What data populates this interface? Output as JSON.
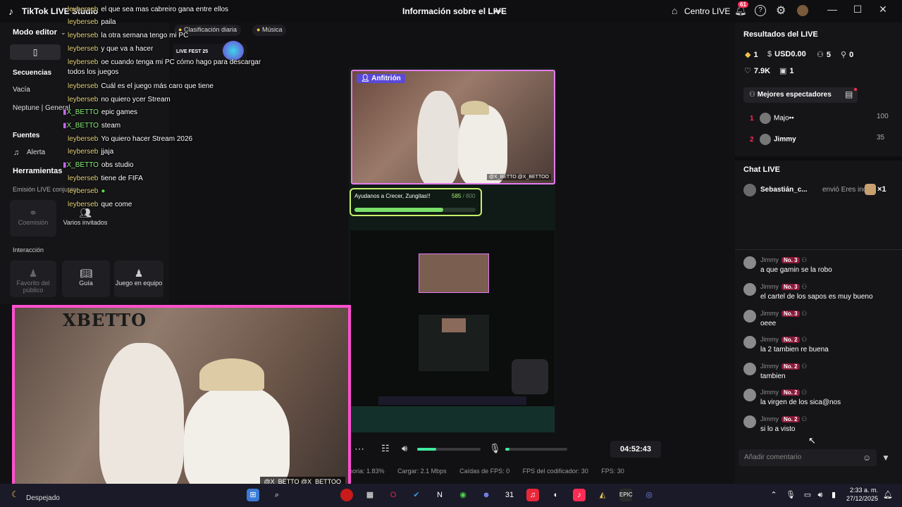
{
  "titlebar": {
    "app_title": "TikTok LIVE Studio",
    "live_info": "Información sobre el LIVE",
    "centro": "Centro LIVE",
    "notifications": "61",
    "win_min": "—",
    "win_max": "☐",
    "win_close": "✕"
  },
  "left": {
    "modo_editor": "Modo editor",
    "secuencias": "Secuencias",
    "vacia": "Vacía",
    "neptune": "Neptune | General",
    "fuentes": "Fuentes",
    "alerta": "Alerta",
    "herramientas": "Herramientas",
    "emision": "Emisión LIVE conjunta",
    "coemision": "Coemisión",
    "varios": "Varios invitados",
    "interaccion": "Interacción",
    "favorito": "Favorito del público",
    "guia": "Guía",
    "juego": "Juego en equipo"
  },
  "pills": {
    "clasificacion": "Clasificación diaria",
    "musica": "Música"
  },
  "overlay_chat": [
    {
      "user": "leyberseb",
      "text": "el que sea mas cabreiro gana entre ellos"
    },
    {
      "user": "leyberseb",
      "text": "paila"
    },
    {
      "user": "leyberseb",
      "text": "la otra semana tengo mi PC"
    },
    {
      "user": "leyberseb",
      "text": "y que va a hacer"
    },
    {
      "user": "leyberseb",
      "text": "oe cuando tenga mi PC cómo hago para descargar todos los juegos"
    },
    {
      "user": "leyberseb",
      "text": "Cuál es el juego más caro que tiene"
    },
    {
      "user": "leyberseb",
      "text": "no quiero ycer Stream"
    },
    {
      "user": "X_BETTO",
      "text": "epic games"
    },
    {
      "user": "X_BETTO",
      "text": "steam"
    },
    {
      "user": "leyberseb",
      "text": "Yo quiero hacer Stream 2026"
    },
    {
      "user": "leyberseb",
      "text": "jjaja"
    },
    {
      "user": "X_BETTO",
      "text": "obs studio"
    },
    {
      "user": "leyberseb",
      "text": "tiene de FIFA"
    },
    {
      "user": "leyberseb",
      "text": ""
    },
    {
      "user": "leyberseb",
      "text": "que come"
    }
  ],
  "preview": {
    "host_label": "Anfitrión",
    "handle": "@X_BETTO @X_BETTOO",
    "goal_text": "Ayudanos a Crecer, Zungitas!!",
    "goal_count": "585",
    "goal_total": "/ 800",
    "goal_progress": 0.73,
    "tiktok_fest": "LIVE FEST 25"
  },
  "controls": {
    "timer": "04:52:43",
    "volume_level": 0.3,
    "mic_level": 0.05
  },
  "stats": {
    "memoria": "noria: 1.83%",
    "cargar": "Cargar: 2.1 Mbps",
    "caidas": "Caídas de FPS: 0",
    "fps_cod": "FPS del codificador: 30",
    "fps": "FPS: 30"
  },
  "webcam": {
    "brand": "XBETTO",
    "handle": "@X_BETTO @X_BETTOO"
  },
  "right": {
    "resultados": "Resultados del LIVE",
    "diamonds": "1",
    "usd": "USD0.00",
    "viewers": "5",
    "followers": "0",
    "likes": "7.9K",
    "gifts": "1",
    "mejores": "Mejores espectadores",
    "top": [
      {
        "rank": "1",
        "name": "Majo••",
        "score": "100"
      },
      {
        "rank": "2",
        "name": "Jimmy",
        "score": "35"
      }
    ],
    "chat_live": "Chat LIVE",
    "gift_user": "Sebastián_c...",
    "gift_text": "envió Eres incre",
    "gift_count": "×1",
    "messages": [
      {
        "user": "Jimmy",
        "badge": "No. 3",
        "text": "a que gamin se la robo"
      },
      {
        "user": "Jimmy",
        "badge": "No. 3",
        "text": "el cartel de los sapos es muy bueno"
      },
      {
        "user": "Jimmy",
        "badge": "No. 3",
        "text": "oeee"
      },
      {
        "user": "Jimmy",
        "badge": "No. 2",
        "text": "la 2 tambien re buena"
      },
      {
        "user": "Jimmy",
        "badge": "No. 2",
        "text": "tambien"
      },
      {
        "user": "Jimmy",
        "badge": "No. 2",
        "text": "la virgen de los sica@nos"
      },
      {
        "user": "Jimmy",
        "badge": "No. 2",
        "text": "si lo a visto"
      }
    ],
    "comment_placeholder": "Añadir comentario"
  },
  "taskbar": {
    "weather": "Despejado",
    "time": "2:33 a. m.",
    "date": "27/12/2025"
  }
}
